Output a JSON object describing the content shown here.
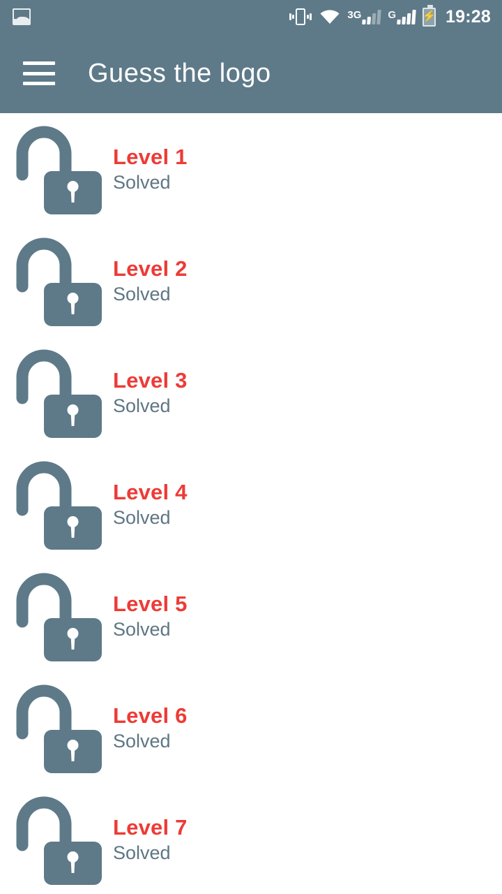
{
  "statusbar": {
    "notification_icon": "photo-icon",
    "vibrate_icon": "vibrate-icon",
    "wifi_icon": "wifi-icon",
    "network_1_label": "3G",
    "network_2_label": "G",
    "battery_icon": "battery-charging-icon",
    "time": "19:28"
  },
  "toolbar": {
    "menu_icon": "hamburger-menu-icon",
    "title": "Guess the logo",
    "background_color": "#5E7A89",
    "text_color": "#FFFFFF"
  },
  "theme": {
    "accent_red": "#ED3B36",
    "slate": "#5E7A89",
    "status_text": "#5E7684",
    "page_background": "#FFFFFF"
  },
  "levels": [
    {
      "title": "Level 1",
      "status": "Solved",
      "lock_icon": "unlocked-padlock-icon"
    },
    {
      "title": "Level 2",
      "status": "Solved",
      "lock_icon": "unlocked-padlock-icon"
    },
    {
      "title": "Level 3",
      "status": "Solved",
      "lock_icon": "unlocked-padlock-icon"
    },
    {
      "title": "Level 4",
      "status": "Solved",
      "lock_icon": "unlocked-padlock-icon"
    },
    {
      "title": "Level 5",
      "status": "Solved",
      "lock_icon": "unlocked-padlock-icon"
    },
    {
      "title": "Level 6",
      "status": "Solved",
      "lock_icon": "unlocked-padlock-icon"
    },
    {
      "title": "Level 7",
      "status": "Solved",
      "lock_icon": "unlocked-padlock-icon"
    }
  ]
}
